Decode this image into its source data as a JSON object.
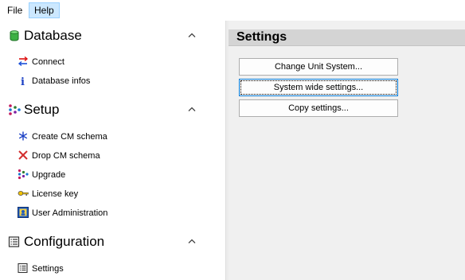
{
  "menu": {
    "file": "File",
    "help": "Help"
  },
  "sidebar": {
    "sections": [
      {
        "title": "Database",
        "icon": "database-icon",
        "items": [
          {
            "label": "Connect",
            "icon": "connect-arrows-icon"
          },
          {
            "label": "Database infos",
            "icon": "info-icon"
          }
        ]
      },
      {
        "title": "Setup",
        "icon": "setup-dots-icon",
        "items": [
          {
            "label": "Create CM schema",
            "icon": "snowflake-icon"
          },
          {
            "label": "Drop CM schema",
            "icon": "red-x-icon"
          },
          {
            "label": "Upgrade",
            "icon": "upgrade-dots-icon"
          },
          {
            "label": "License key",
            "icon": "key-icon"
          },
          {
            "label": "User Administration",
            "icon": "user-admin-icon"
          }
        ]
      },
      {
        "title": "Configuration",
        "icon": "configuration-list-icon",
        "items": [
          {
            "label": "Settings",
            "icon": "settings-list-icon"
          }
        ]
      }
    ]
  },
  "main": {
    "title": "Settings",
    "buttons": [
      {
        "label": "Change Unit System..."
      },
      {
        "label": "System wide settings...",
        "focused": true
      },
      {
        "label": "Copy settings..."
      }
    ]
  },
  "colors": {
    "menu_highlight": "#cce8ff",
    "panel_header": "#d4d4d4",
    "panel_bg": "#f0f0f0",
    "focus_border": "#0078d7"
  }
}
